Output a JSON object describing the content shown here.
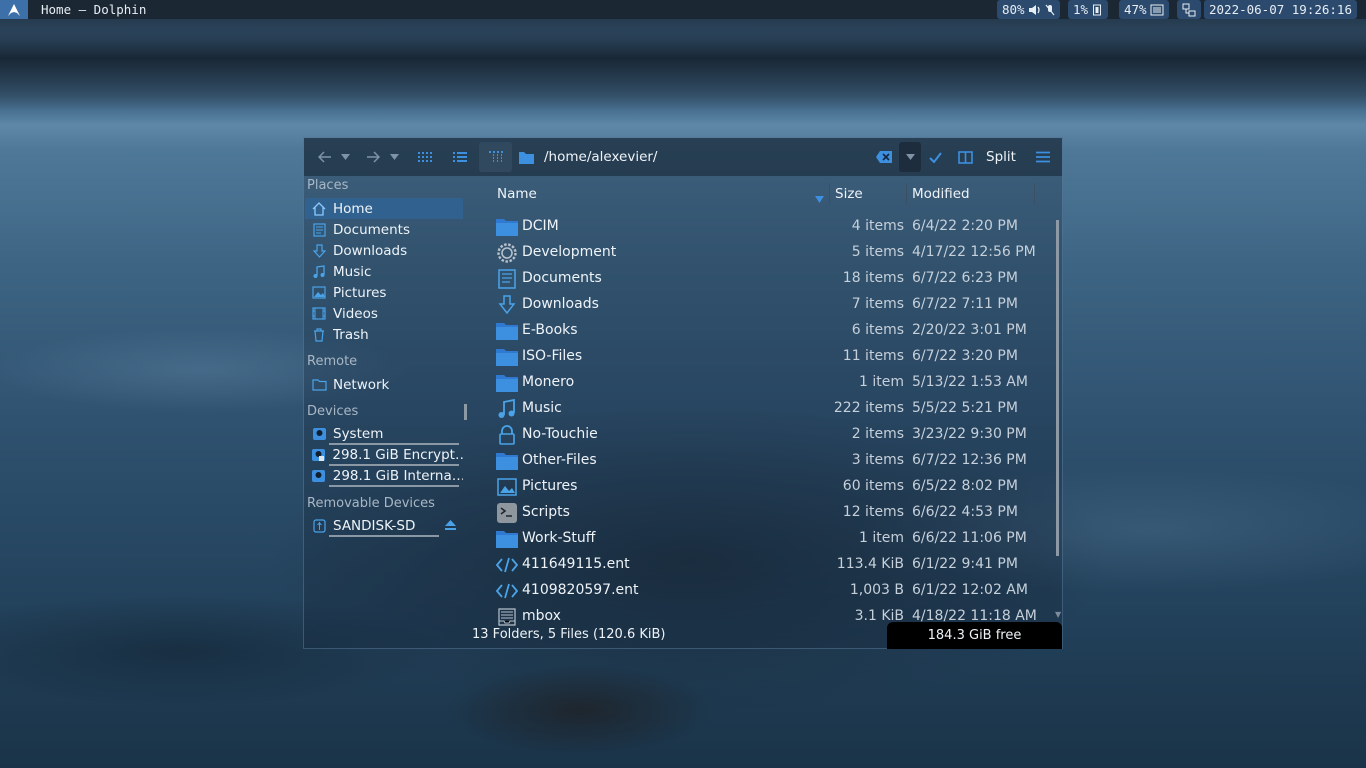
{
  "panel": {
    "window_title": "Home — Dolphin",
    "volume": "80%",
    "cpu": "1%",
    "memory": "47%",
    "datetime": "2022-06-07 19:26:16"
  },
  "toolbar": {
    "path": "/home/alexevier/",
    "split_label": "Split"
  },
  "sidebar": {
    "places_header": "Places",
    "places": [
      {
        "label": "Home",
        "icon": "home-icon"
      },
      {
        "label": "Documents",
        "icon": "document-icon"
      },
      {
        "label": "Downloads",
        "icon": "download-icon"
      },
      {
        "label": "Music",
        "icon": "music-icon"
      },
      {
        "label": "Pictures",
        "icon": "picture-icon"
      },
      {
        "label": "Videos",
        "icon": "video-icon"
      },
      {
        "label": "Trash",
        "icon": "trash-icon"
      }
    ],
    "remote_header": "Remote",
    "remote": [
      {
        "label": "Network",
        "icon": "network-icon"
      }
    ],
    "devices_header": "Devices",
    "devices": [
      {
        "label": "System",
        "icon": "drive-icon"
      },
      {
        "label": "298.1 GiB Encrypt…",
        "icon": "encrypted-drive-icon"
      },
      {
        "label": "298.1 GiB Interna…",
        "icon": "drive-icon"
      }
    ],
    "removable_header": "Removable Devices",
    "removable": [
      {
        "label": "SANDISK-SD",
        "icon": "usb-icon"
      }
    ]
  },
  "columns": {
    "name": "Name",
    "size": "Size",
    "modified": "Modified"
  },
  "files": [
    {
      "name": "DCIM",
      "size": "4 items",
      "modified": "6/4/22 2:20 PM",
      "icon": "folder-icon"
    },
    {
      "name": "Development",
      "size": "5 items",
      "modified": "4/17/22 12:56 PM",
      "icon": "gear-folder-icon"
    },
    {
      "name": "Documents",
      "size": "18 items",
      "modified": "6/7/22 6:23 PM",
      "icon": "documents-folder-icon"
    },
    {
      "name": "Downloads",
      "size": "7 items",
      "modified": "6/7/22 7:11 PM",
      "icon": "downloads-folder-icon"
    },
    {
      "name": "E-Books",
      "size": "6 items",
      "modified": "2/20/22 3:01 PM",
      "icon": "folder-icon"
    },
    {
      "name": "ISO-Files",
      "size": "11 items",
      "modified": "6/7/22 3:20 PM",
      "icon": "folder-icon"
    },
    {
      "name": "Monero",
      "size": "1 item",
      "modified": "5/13/22 1:53 AM",
      "icon": "folder-icon"
    },
    {
      "name": "Music",
      "size": "222 items",
      "modified": "5/5/22 5:21 PM",
      "icon": "music-folder-icon"
    },
    {
      "name": "No-Touchie",
      "size": "2 items",
      "modified": "3/23/22 9:30 PM",
      "icon": "lock-folder-icon"
    },
    {
      "name": "Other-Files",
      "size": "3 items",
      "modified": "6/7/22 12:36 PM",
      "icon": "folder-icon"
    },
    {
      "name": "Pictures",
      "size": "60 items",
      "modified": "6/5/22 8:02 PM",
      "icon": "pictures-folder-icon"
    },
    {
      "name": "Scripts",
      "size": "12 items",
      "modified": "6/6/22 4:53 PM",
      "icon": "terminal-folder-icon"
    },
    {
      "name": "Work-Stuff",
      "size": "1 item",
      "modified": "6/6/22 11:06 PM",
      "icon": "folder-icon"
    },
    {
      "name": "411649115.ent",
      "size": "113.4 KiB",
      "modified": "6/1/22 9:41 PM",
      "icon": "code-file-icon"
    },
    {
      "name": "4109820597.ent",
      "size": "1,003 B",
      "modified": "6/1/22 12:02 AM",
      "icon": "code-file-icon"
    },
    {
      "name": "mbox",
      "size": "3.1 KiB",
      "modified": "4/18/22 11:18 AM",
      "icon": "mbox-file-icon"
    }
  ],
  "status": {
    "summary": "13 Folders, 5 Files (120.6 KiB)",
    "free_space": "184.3 GiB free"
  },
  "colors": {
    "accent": "#3d8fe0",
    "selection": "#31618f",
    "folder": "#3d8fe0"
  }
}
